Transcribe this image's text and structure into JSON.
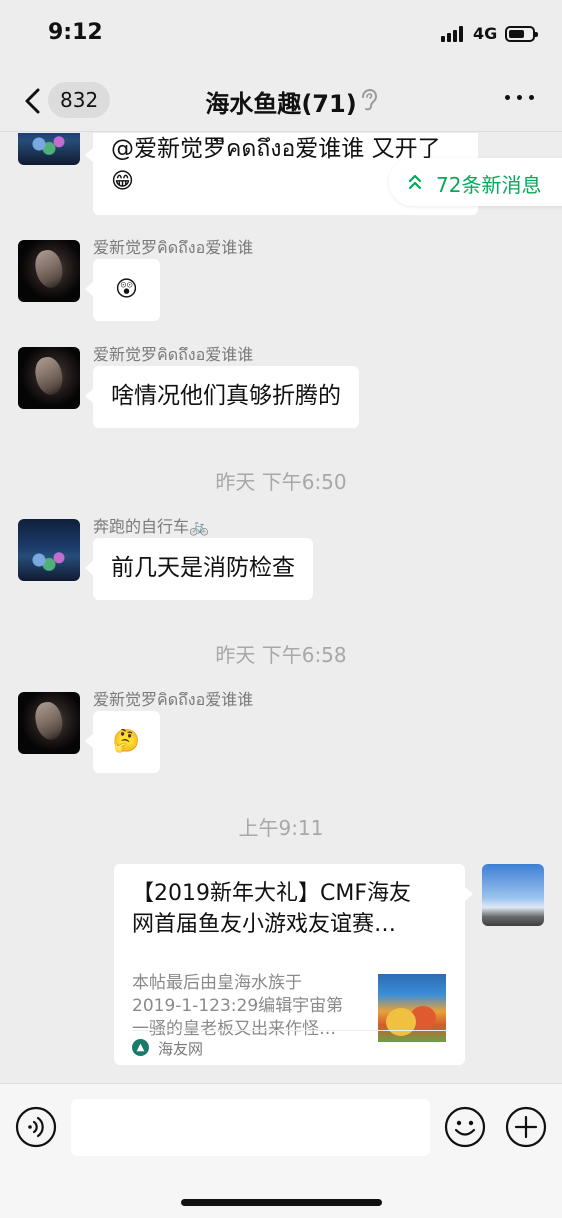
{
  "status_bar": {
    "time": "9:12",
    "network": "4G",
    "icons": [
      "signal-icon",
      "battery-icon"
    ]
  },
  "header": {
    "back_icon": "chevron-left-icon",
    "unread_count": "832",
    "title": "海水鱼趣(71)",
    "mute_icon": "ear-icon",
    "more_icon": "more-dots-icon"
  },
  "new_messages": {
    "label": "72条新消息",
    "icon": "double-chevron-up-icon",
    "accent_color": "#07a85a"
  },
  "messages": [
    {
      "type": "text",
      "side": "left",
      "text": "@爱新觉罗ิคดถึงอ爱谁谁 又开了",
      "emoji": "😁"
    },
    {
      "type": "emoji",
      "side": "left",
      "sender": "爱新觉罗คิดถึงอ爱谁谁",
      "emoji": "😲"
    },
    {
      "type": "text",
      "side": "left",
      "sender": "爱新觉罗คิดถึงอ爱谁谁",
      "text": "啥情况他们真够折腾的"
    },
    {
      "type": "timestamp",
      "text": "昨天 下午6:50"
    },
    {
      "type": "text",
      "side": "left",
      "sender": "奔跑的自行车🚲",
      "text": "前几天是消防检查"
    },
    {
      "type": "timestamp",
      "text": "昨天 下午6:58"
    },
    {
      "type": "emoji",
      "side": "left",
      "sender": "爱新觉罗คิดถึงอ爱谁谁",
      "emoji": "🤔"
    },
    {
      "type": "timestamp",
      "text": "上午9:11"
    },
    {
      "type": "link",
      "side": "right",
      "title": "【2019新年大礼】CMF海友\n网首届鱼友小游戏友谊赛…",
      "description": "本帖最后由皇海水族于\n2019-1-123:29编辑宇宙第\n一骚的皇老板又出来作怪…",
      "source": "海友网"
    }
  ],
  "input_bar": {
    "voice_icon": "voice-icon",
    "input_value": "",
    "emoji_icon": "emoji-icon",
    "plus_icon": "plus-icon"
  }
}
